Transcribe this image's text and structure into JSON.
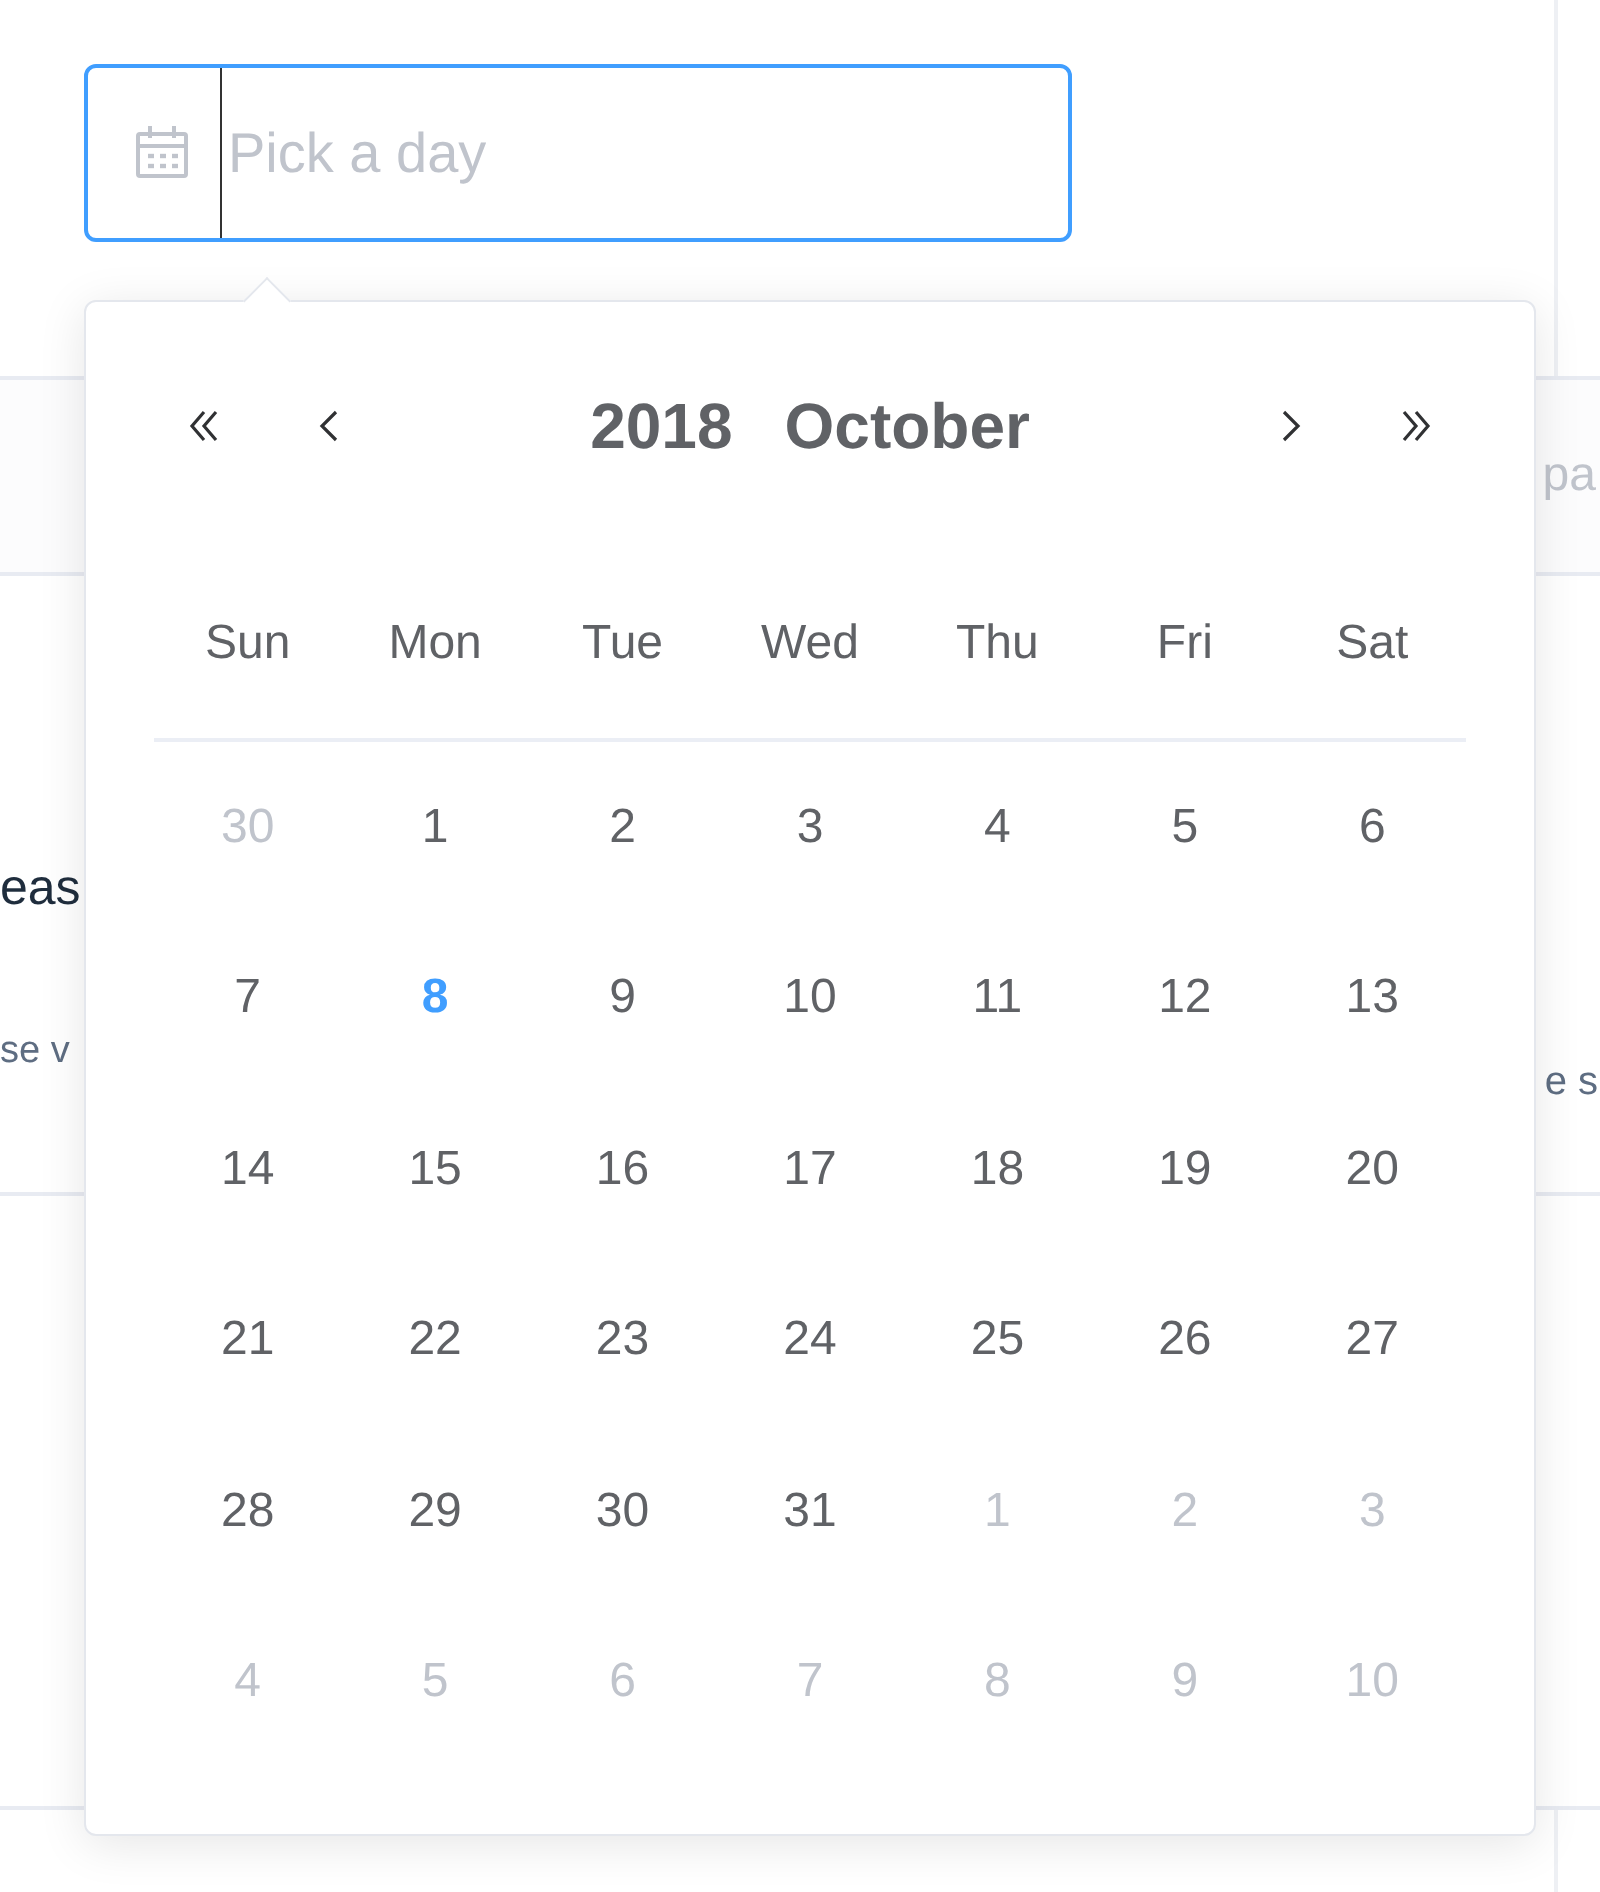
{
  "date_input": {
    "placeholder": "Pick a day"
  },
  "background": {
    "field_fragment": "pa",
    "heading_fragment": "eas",
    "text_fragment_left": "se v",
    "text_fragment_right": "e s"
  },
  "calendar": {
    "year": "2018",
    "month": "October",
    "weekdays": [
      "Sun",
      "Mon",
      "Tue",
      "Wed",
      "Thu",
      "Fri",
      "Sat"
    ],
    "days": [
      {
        "label": "30",
        "in_month": false,
        "today": false
      },
      {
        "label": "1",
        "in_month": true,
        "today": false
      },
      {
        "label": "2",
        "in_month": true,
        "today": false
      },
      {
        "label": "3",
        "in_month": true,
        "today": false
      },
      {
        "label": "4",
        "in_month": true,
        "today": false
      },
      {
        "label": "5",
        "in_month": true,
        "today": false
      },
      {
        "label": "6",
        "in_month": true,
        "today": false
      },
      {
        "label": "7",
        "in_month": true,
        "today": false
      },
      {
        "label": "8",
        "in_month": true,
        "today": true
      },
      {
        "label": "9",
        "in_month": true,
        "today": false
      },
      {
        "label": "10",
        "in_month": true,
        "today": false
      },
      {
        "label": "11",
        "in_month": true,
        "today": false
      },
      {
        "label": "12",
        "in_month": true,
        "today": false
      },
      {
        "label": "13",
        "in_month": true,
        "today": false
      },
      {
        "label": "14",
        "in_month": true,
        "today": false
      },
      {
        "label": "15",
        "in_month": true,
        "today": false
      },
      {
        "label": "16",
        "in_month": true,
        "today": false
      },
      {
        "label": "17",
        "in_month": true,
        "today": false
      },
      {
        "label": "18",
        "in_month": true,
        "today": false
      },
      {
        "label": "19",
        "in_month": true,
        "today": false
      },
      {
        "label": "20",
        "in_month": true,
        "today": false
      },
      {
        "label": "21",
        "in_month": true,
        "today": false
      },
      {
        "label": "22",
        "in_month": true,
        "today": false
      },
      {
        "label": "23",
        "in_month": true,
        "today": false
      },
      {
        "label": "24",
        "in_month": true,
        "today": false
      },
      {
        "label": "25",
        "in_month": true,
        "today": false
      },
      {
        "label": "26",
        "in_month": true,
        "today": false
      },
      {
        "label": "27",
        "in_month": true,
        "today": false
      },
      {
        "label": "28",
        "in_month": true,
        "today": false
      },
      {
        "label": "29",
        "in_month": true,
        "today": false
      },
      {
        "label": "30",
        "in_month": true,
        "today": false
      },
      {
        "label": "31",
        "in_month": true,
        "today": false
      },
      {
        "label": "1",
        "in_month": false,
        "today": false
      },
      {
        "label": "2",
        "in_month": false,
        "today": false
      },
      {
        "label": "3",
        "in_month": false,
        "today": false
      },
      {
        "label": "4",
        "in_month": false,
        "today": false
      },
      {
        "label": "5",
        "in_month": false,
        "today": false
      },
      {
        "label": "6",
        "in_month": false,
        "today": false
      },
      {
        "label": "7",
        "in_month": false,
        "today": false
      },
      {
        "label": "8",
        "in_month": false,
        "today": false
      },
      {
        "label": "9",
        "in_month": false,
        "today": false
      },
      {
        "label": "10",
        "in_month": false,
        "today": false
      }
    ]
  }
}
